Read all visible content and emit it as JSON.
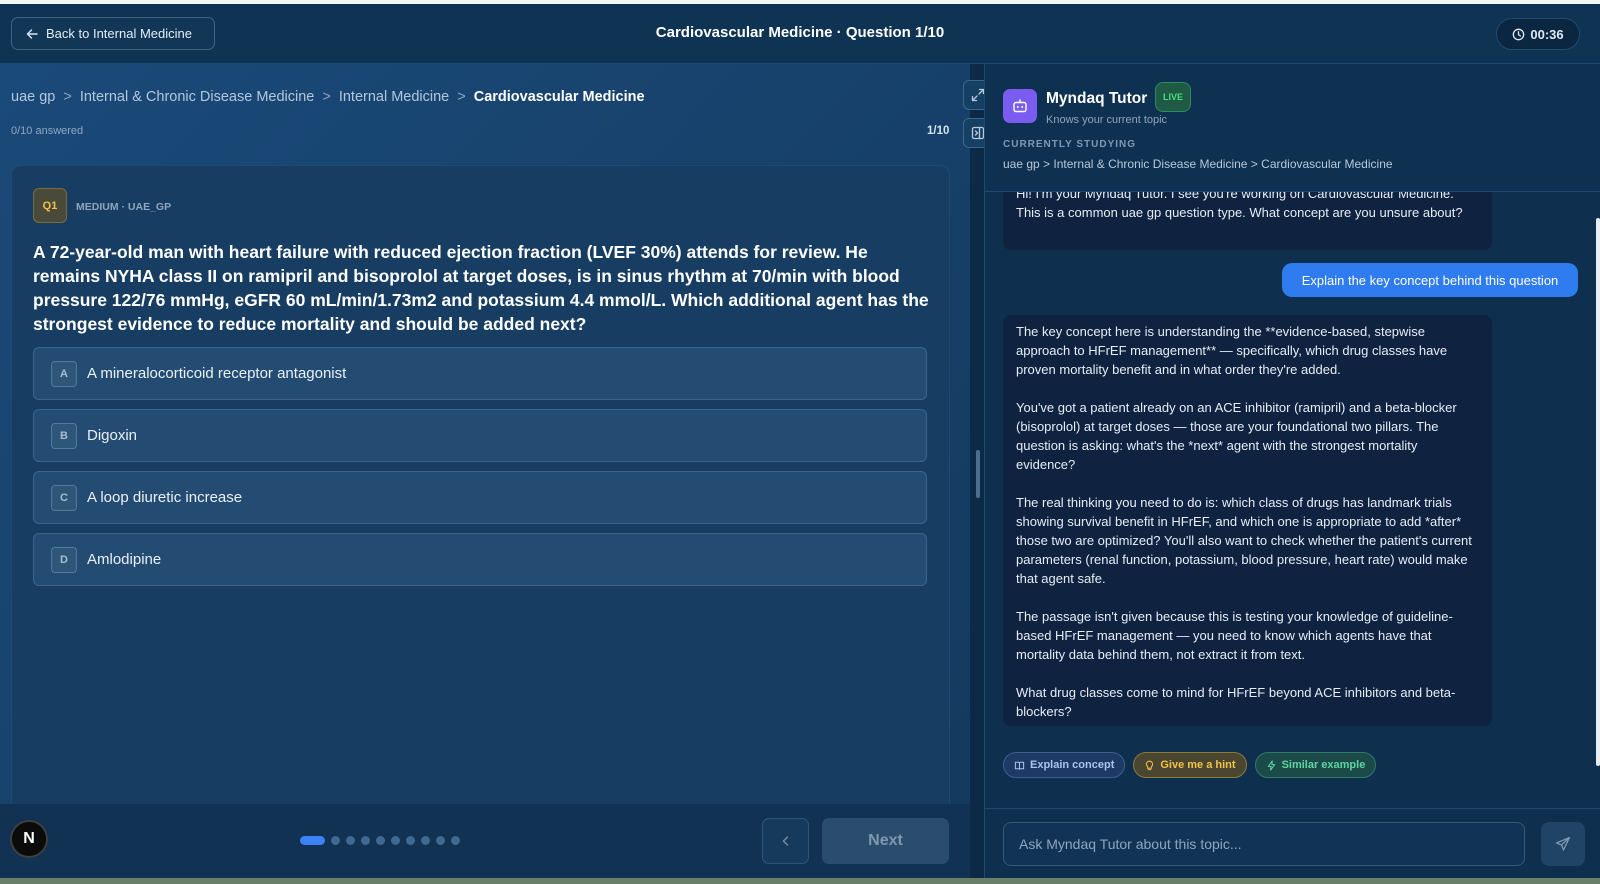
{
  "header": {
    "back_label": "Back to Internal Medicine",
    "title": "Cardiovascular Medicine · Question 1/10",
    "timer": "00:36"
  },
  "breadcrumb": {
    "items": [
      "uae gp",
      "Internal & Chronic Disease Medicine",
      "Internal Medicine",
      "Cardiovascular Medicine"
    ],
    "separator": ">"
  },
  "progress": {
    "answered_text": "0/10 answered",
    "counter": "1/10",
    "current_index": 1,
    "total": 10
  },
  "question": {
    "badge": "Q1",
    "meta": "MEDIUM · UAE_GP",
    "text": "A 72-year-old man with heart failure with reduced ejection fraction (LVEF 30%) attends for review. He remains NYHA class II on ramipril and bisoprolol at target doses, is in sinus rhythm at 70/min with blood pressure 122/76 mmHg, eGFR 60 mL/min/1.73m2 and potassium 4.4 mmol/L. Which additional agent has the strongest evidence to reduce mortality and should be added next?",
    "options": [
      {
        "letter": "A",
        "text": "A mineralocorticoid receptor antagonist"
      },
      {
        "letter": "B",
        "text": "Digoxin"
      },
      {
        "letter": "C",
        "text": "A loop diuretic increase"
      },
      {
        "letter": "D",
        "text": "Amlodipine"
      }
    ]
  },
  "nav": {
    "avatar_letter": "N",
    "next_label": "Next"
  },
  "tutor": {
    "name": "Myndaq Tutor",
    "live": "LIVE",
    "subtitle": "Knows your current topic",
    "studying_label": "CURRENTLY STUDYING",
    "studying_path": "uae gp > Internal & Chronic Disease Medicine > Cardiovascular Medicine",
    "messages": {
      "bot1": "Hi! I'm your Myndaq Tutor. I see you're working on Cardiovascular Medicine. This is a common uae gp question type. What concept are you unsure about?",
      "user1": "Explain the key concept behind this question",
      "bot2_p1": "The key concept here is understanding the **evidence-based, stepwise approach to HFrEF management** — specifically, which drug classes have proven mortality benefit and in what order they're added.",
      "bot2_p2": "You've got a patient already on an ACE inhibitor (ramipril) and a beta-blocker (bisoprolol) at target doses — those are your foundational two pillars. The question is asking: what's the *next* agent with the strongest mortality evidence?",
      "bot2_p3": "The real thinking you need to do is: which class of drugs has landmark trials showing survival benefit in HFrEF, and which one is appropriate to add *after* those two are optimized? You'll also want to check whether the patient's current parameters (renal function, potassium, blood pressure, heart rate) would make that agent safe.",
      "bot2_p4": "The passage isn't given because this is testing your knowledge of guideline-based HFrEF management — you need to know which agents have that mortality data behind them, not extract it from text.",
      "bot2_p5": "What drug classes come to mind for HFrEF beyond ACE inhibitors and beta-blockers?"
    },
    "chips": {
      "explain": "Explain concept",
      "hint": "Give me a hint",
      "similar": "Similar example"
    },
    "input_placeholder": "Ask Myndaq Tutor about this topic..."
  },
  "colors": {
    "accent": "#3b82f6",
    "live_green": "#4ade80",
    "badge_yellow": "#f3c14a",
    "bot_purple": "#7b5cf0"
  }
}
